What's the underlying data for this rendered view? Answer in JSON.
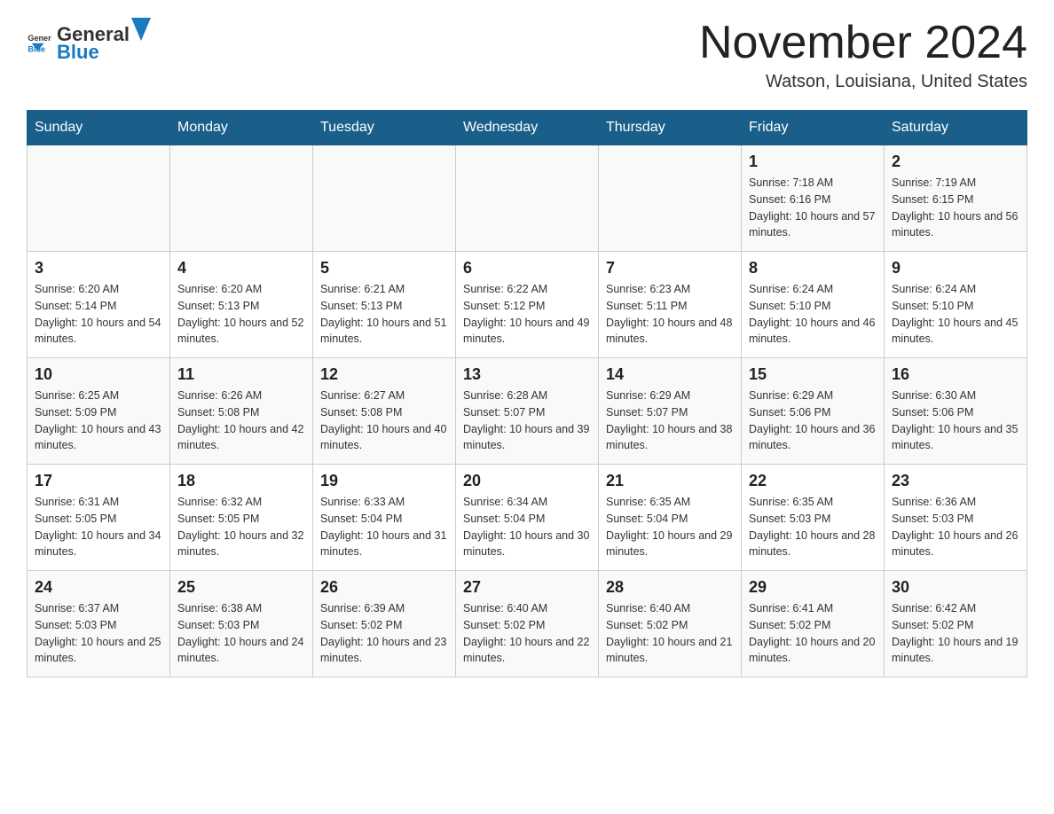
{
  "header": {
    "logo_general": "General",
    "logo_blue": "Blue",
    "month_title": "November 2024",
    "location": "Watson, Louisiana, United States"
  },
  "days_of_week": [
    "Sunday",
    "Monday",
    "Tuesday",
    "Wednesday",
    "Thursday",
    "Friday",
    "Saturday"
  ],
  "weeks": [
    [
      {
        "day": "",
        "info": ""
      },
      {
        "day": "",
        "info": ""
      },
      {
        "day": "",
        "info": ""
      },
      {
        "day": "",
        "info": ""
      },
      {
        "day": "",
        "info": ""
      },
      {
        "day": "1",
        "info": "Sunrise: 7:18 AM\nSunset: 6:16 PM\nDaylight: 10 hours and 57 minutes."
      },
      {
        "day": "2",
        "info": "Sunrise: 7:19 AM\nSunset: 6:15 PM\nDaylight: 10 hours and 56 minutes."
      }
    ],
    [
      {
        "day": "3",
        "info": "Sunrise: 6:20 AM\nSunset: 5:14 PM\nDaylight: 10 hours and 54 minutes."
      },
      {
        "day": "4",
        "info": "Sunrise: 6:20 AM\nSunset: 5:13 PM\nDaylight: 10 hours and 52 minutes."
      },
      {
        "day": "5",
        "info": "Sunrise: 6:21 AM\nSunset: 5:13 PM\nDaylight: 10 hours and 51 minutes."
      },
      {
        "day": "6",
        "info": "Sunrise: 6:22 AM\nSunset: 5:12 PM\nDaylight: 10 hours and 49 minutes."
      },
      {
        "day": "7",
        "info": "Sunrise: 6:23 AM\nSunset: 5:11 PM\nDaylight: 10 hours and 48 minutes."
      },
      {
        "day": "8",
        "info": "Sunrise: 6:24 AM\nSunset: 5:10 PM\nDaylight: 10 hours and 46 minutes."
      },
      {
        "day": "9",
        "info": "Sunrise: 6:24 AM\nSunset: 5:10 PM\nDaylight: 10 hours and 45 minutes."
      }
    ],
    [
      {
        "day": "10",
        "info": "Sunrise: 6:25 AM\nSunset: 5:09 PM\nDaylight: 10 hours and 43 minutes."
      },
      {
        "day": "11",
        "info": "Sunrise: 6:26 AM\nSunset: 5:08 PM\nDaylight: 10 hours and 42 minutes."
      },
      {
        "day": "12",
        "info": "Sunrise: 6:27 AM\nSunset: 5:08 PM\nDaylight: 10 hours and 40 minutes."
      },
      {
        "day": "13",
        "info": "Sunrise: 6:28 AM\nSunset: 5:07 PM\nDaylight: 10 hours and 39 minutes."
      },
      {
        "day": "14",
        "info": "Sunrise: 6:29 AM\nSunset: 5:07 PM\nDaylight: 10 hours and 38 minutes."
      },
      {
        "day": "15",
        "info": "Sunrise: 6:29 AM\nSunset: 5:06 PM\nDaylight: 10 hours and 36 minutes."
      },
      {
        "day": "16",
        "info": "Sunrise: 6:30 AM\nSunset: 5:06 PM\nDaylight: 10 hours and 35 minutes."
      }
    ],
    [
      {
        "day": "17",
        "info": "Sunrise: 6:31 AM\nSunset: 5:05 PM\nDaylight: 10 hours and 34 minutes."
      },
      {
        "day": "18",
        "info": "Sunrise: 6:32 AM\nSunset: 5:05 PM\nDaylight: 10 hours and 32 minutes."
      },
      {
        "day": "19",
        "info": "Sunrise: 6:33 AM\nSunset: 5:04 PM\nDaylight: 10 hours and 31 minutes."
      },
      {
        "day": "20",
        "info": "Sunrise: 6:34 AM\nSunset: 5:04 PM\nDaylight: 10 hours and 30 minutes."
      },
      {
        "day": "21",
        "info": "Sunrise: 6:35 AM\nSunset: 5:04 PM\nDaylight: 10 hours and 29 minutes."
      },
      {
        "day": "22",
        "info": "Sunrise: 6:35 AM\nSunset: 5:03 PM\nDaylight: 10 hours and 28 minutes."
      },
      {
        "day": "23",
        "info": "Sunrise: 6:36 AM\nSunset: 5:03 PM\nDaylight: 10 hours and 26 minutes."
      }
    ],
    [
      {
        "day": "24",
        "info": "Sunrise: 6:37 AM\nSunset: 5:03 PM\nDaylight: 10 hours and 25 minutes."
      },
      {
        "day": "25",
        "info": "Sunrise: 6:38 AM\nSunset: 5:03 PM\nDaylight: 10 hours and 24 minutes."
      },
      {
        "day": "26",
        "info": "Sunrise: 6:39 AM\nSunset: 5:02 PM\nDaylight: 10 hours and 23 minutes."
      },
      {
        "day": "27",
        "info": "Sunrise: 6:40 AM\nSunset: 5:02 PM\nDaylight: 10 hours and 22 minutes."
      },
      {
        "day": "28",
        "info": "Sunrise: 6:40 AM\nSunset: 5:02 PM\nDaylight: 10 hours and 21 minutes."
      },
      {
        "day": "29",
        "info": "Sunrise: 6:41 AM\nSunset: 5:02 PM\nDaylight: 10 hours and 20 minutes."
      },
      {
        "day": "30",
        "info": "Sunrise: 6:42 AM\nSunset: 5:02 PM\nDaylight: 10 hours and 19 minutes."
      }
    ]
  ]
}
